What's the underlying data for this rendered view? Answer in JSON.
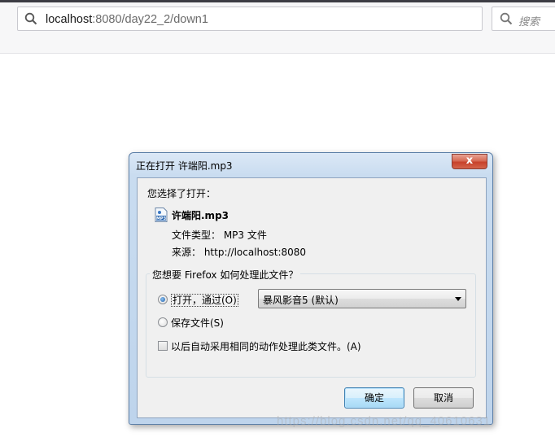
{
  "browser": {
    "url_host": "localhost",
    "url_path": ":8080/day22_2/down1",
    "search_placeholder": "搜索"
  },
  "dialog": {
    "title": "正在打开 许端阳.mp3",
    "close_label": "x",
    "chosen_label": "您选择了打开：",
    "file_name": "许端阳.mp3",
    "file_type": "文件类型： MP3 文件",
    "source": "来源： http://localhost:8080",
    "question": "您想要 Firefox 如何处理此文件？",
    "options": {
      "open_with_label": "打开，通过(O)",
      "open_with_selected": true,
      "save_file_label": "保存文件(S)",
      "save_file_selected": false,
      "auto_label": "以后自动采用相同的动作处理此类文件。(A)",
      "auto_checked": false
    },
    "app_select_value": "暴风影音5 (默认)",
    "ok_label": "确定",
    "cancel_label": "取消"
  },
  "watermark": "https://blog.csdn.net/qq_40610631",
  "colors": {
    "dialog_frame": "#bed4ec",
    "close_button": "#c7412b",
    "default_button": "#a7d9f5"
  }
}
